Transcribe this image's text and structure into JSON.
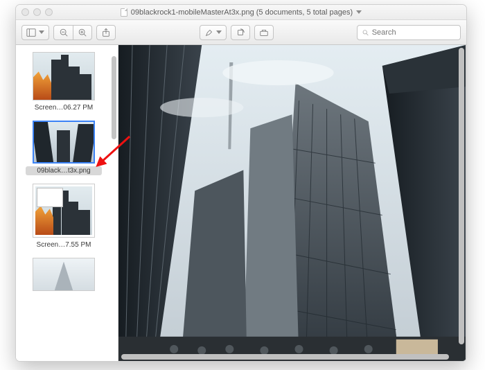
{
  "window": {
    "title": "09blackrock1-mobileMasterAt3x.png (5 documents, 5 total pages)"
  },
  "toolbar": {
    "search_placeholder": "Search"
  },
  "sidebar": {
    "items": [
      {
        "label": "Screen…06.27 PM"
      },
      {
        "label": "09black…t3x.png"
      },
      {
        "label": "Screen…7.55 PM"
      },
      {
        "label": ""
      }
    ]
  }
}
